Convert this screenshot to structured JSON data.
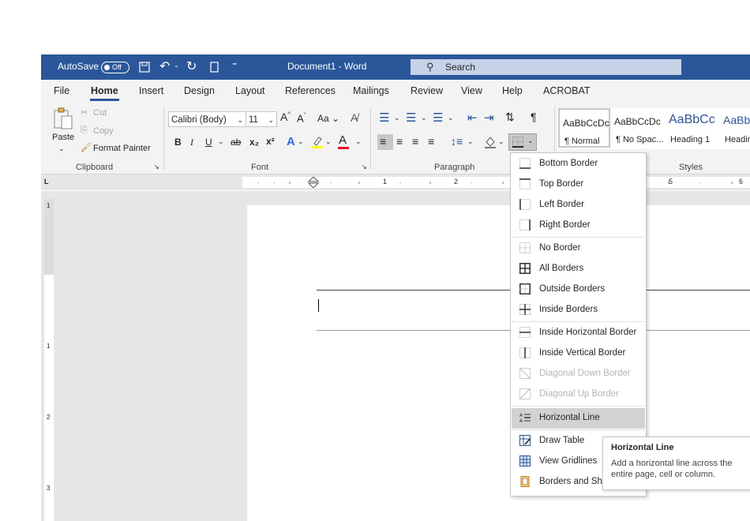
{
  "titlebar": {
    "autosave_label": "AutoSave",
    "autosave_state": "Off",
    "doc_title": "Document1  -  Word",
    "search_placeholder": "Search"
  },
  "tabs": [
    "File",
    "Home",
    "Insert",
    "Design",
    "Layout",
    "References",
    "Mailings",
    "Review",
    "View",
    "Help",
    "ACROBAT"
  ],
  "active_tab": "Home",
  "clipboard": {
    "paste": "Paste",
    "cut": "Cut",
    "copy": "Copy",
    "format_painter": "Format Painter",
    "group": "Clipboard"
  },
  "font": {
    "name": "Calibri (Body)",
    "size": "11",
    "group": "Font",
    "bold": "B",
    "italic": "I",
    "underline": "U",
    "strike": "ab",
    "sub": "x₂",
    "sup": "x²",
    "case": "Aa",
    "grow": "A^",
    "shrink": "Aˇ"
  },
  "paragraph": {
    "group": "Paragraph",
    "pilcrow": "¶"
  },
  "styles": {
    "group": "Styles",
    "items": [
      {
        "preview": "AaBbCcDc",
        "name": "¶ Normal"
      },
      {
        "preview": "AaBbCcDc",
        "name": "¶ No Spac..."
      },
      {
        "preview": "AaBbCc",
        "name": "Heading 1"
      },
      {
        "preview": "AaBbC",
        "name": "Headin"
      }
    ]
  },
  "ruler": {
    "h_marks": [
      "1",
      "2",
      "5",
      "6"
    ],
    "v_marks": [
      "1",
      "1",
      "2",
      "3"
    ]
  },
  "borders_menu": {
    "items": [
      {
        "label": "Bottom Border",
        "icon": "bottom-border-icon",
        "enabled": true
      },
      {
        "label": "Top Border",
        "icon": "top-border-icon",
        "enabled": true
      },
      {
        "label": "Left Border",
        "icon": "left-border-icon",
        "enabled": true
      },
      {
        "label": "Right Border",
        "icon": "right-border-icon",
        "enabled": true
      },
      {
        "label": "No Border",
        "icon": "no-border-icon",
        "enabled": true
      },
      {
        "label": "All Borders",
        "icon": "all-borders-icon",
        "enabled": true
      },
      {
        "label": "Outside Borders",
        "icon": "outside-borders-icon",
        "enabled": true
      },
      {
        "label": "Inside Borders",
        "icon": "inside-borders-icon",
        "enabled": true
      },
      {
        "label": "Inside Horizontal Border",
        "icon": "inside-horizontal-border-icon",
        "enabled": true
      },
      {
        "label": "Inside Vertical Border",
        "icon": "inside-vertical-border-icon",
        "enabled": true
      },
      {
        "label": "Diagonal Down Border",
        "icon": "diagonal-down-border-icon",
        "enabled": false
      },
      {
        "label": "Diagonal Up Border",
        "icon": "diagonal-up-border-icon",
        "enabled": false
      },
      {
        "label": "Horizontal Line",
        "icon": "horizontal-line-icon",
        "enabled": true,
        "highlighted": true
      },
      {
        "label": "Draw Table",
        "icon": "draw-table-icon",
        "enabled": true
      },
      {
        "label": "View Gridlines",
        "icon": "view-gridlines-icon",
        "enabled": true
      },
      {
        "label": "Borders and Sha",
        "icon": "borders-shading-icon",
        "enabled": true
      }
    ]
  },
  "tooltip": {
    "title": "Horizontal Line",
    "body": "Add a horizontal line across the entire page, cell or column."
  },
  "colors": {
    "accent": "#2b579a",
    "font_color": "#e81123",
    "highlight": "#ffff00"
  }
}
